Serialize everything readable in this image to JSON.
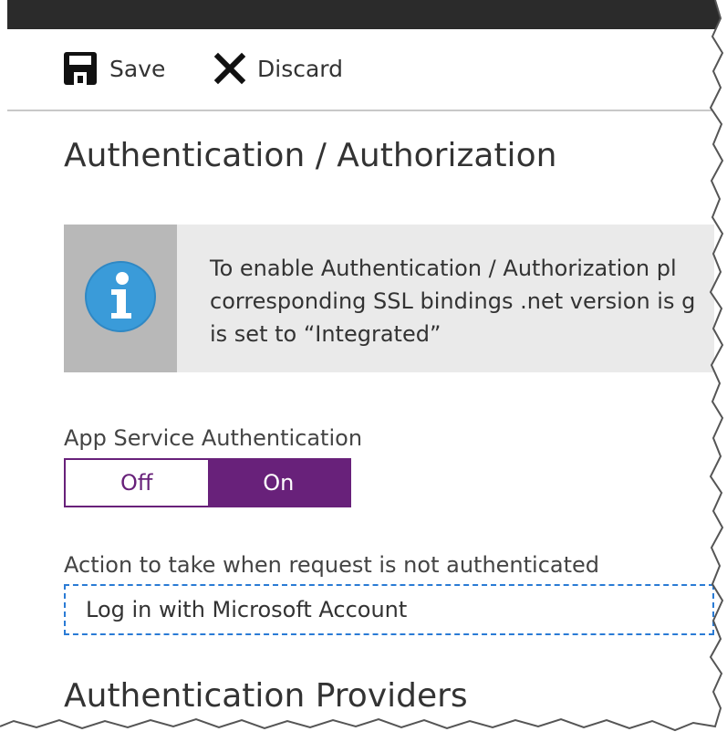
{
  "toolbar": {
    "save_label": "Save",
    "save_icon": "floppy-disk-icon",
    "discard_label": "Discard",
    "discard_icon": "x-close-icon"
  },
  "page": {
    "title": "Authentication / Authorization"
  },
  "info": {
    "icon": "info-icon",
    "lines": [
      "To enable Authentication / Authorization pl",
      "corresponding SSL bindings .net version is g",
      "is set to “Integrated”"
    ]
  },
  "app_service_auth": {
    "label": "App Service Authentication",
    "options": [
      "Off",
      "On"
    ],
    "selected": "On"
  },
  "action": {
    "label": "Action to take when request is not authenticated",
    "value": "Log in with Microsoft Account"
  },
  "providers": {
    "heading": "Authentication Providers"
  },
  "colors": {
    "accent": "#68217a",
    "info_blue": "#3a9bd9",
    "focus_border": "#2a7bd5"
  }
}
